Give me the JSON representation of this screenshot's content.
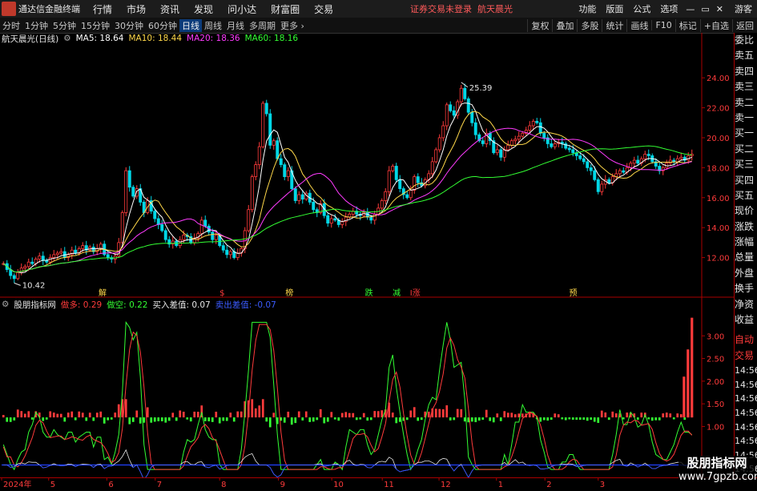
{
  "app": {
    "title": "通达信金融终端",
    "status": "证券交易未登录",
    "stock_name": "航天晨光"
  },
  "menu": [
    "行情",
    "市场",
    "资讯",
    "发现",
    "问小达",
    "财富圈",
    "交易"
  ],
  "right_menu": [
    "功能",
    "版面",
    "公式",
    "选项",
    "游客"
  ],
  "periods": [
    "分时",
    "1分钟",
    "5分钟",
    "15分钟",
    "30分钟",
    "60分钟",
    "日线",
    "周线",
    "月线",
    "多周期",
    "更多"
  ],
  "active_period": "日线",
  "tools": [
    "复权",
    "叠加",
    "多股",
    "统计",
    "画线",
    "F10",
    "标记",
    "+自选",
    "返回"
  ],
  "main_info": {
    "name": "航天晨光(日线)",
    "ma5": "MA5: 18.64",
    "ma10": "MA10: 18.44",
    "ma20": "MA20: 18.36",
    "ma60": "MA60: 18.16"
  },
  "indicator_info": {
    "name": "股朋指标网",
    "duo": "做多: 0.29",
    "kong": "做空: 0.22",
    "buy": "买入差值: 0.07",
    "sell": "卖出差值: -0.07"
  },
  "price_axis": [
    "24.00",
    "22.00",
    "20.00",
    "18.00",
    "16.00",
    "14.00",
    "12.00"
  ],
  "indicator_axis": [
    "3.00",
    "2.50",
    "2.00",
    "1.50",
    "1.00"
  ],
  "annotations": {
    "high": "25.39",
    "low": "10.42"
  },
  "event_markers": [
    "解",
    "$",
    "榜",
    "跌",
    "减",
    "I涨",
    "预"
  ],
  "x_labels": [
    "2024年",
    "5",
    "6",
    "7",
    "8",
    "9",
    "10",
    "11",
    "12",
    "1",
    "2",
    "3"
  ],
  "side_panel": [
    "委比",
    "卖五",
    "卖四",
    "卖三",
    "卖二",
    "卖一",
    "买一",
    "买二",
    "买三",
    "买四",
    "买五",
    "现价",
    "涨跌",
    "涨幅",
    "总量",
    "外盘",
    "换手",
    "净资",
    "收益"
  ],
  "side_panel2": [
    "自动",
    "交易"
  ],
  "side_times": [
    "14:56",
    "14:56",
    "14:56",
    "14:56",
    "14:56",
    "14:56",
    "14:56",
    "14:56",
    "14:56"
  ],
  "watermark": {
    "line1": "股朋指标网",
    "line2": "www.7gpzb.com"
  },
  "colors": {
    "up": "#ff3b3b",
    "down": "#00d7e6",
    "ma5": "#ffffff",
    "ma10": "#ffd84a",
    "ma20": "#ff3bff",
    "ma60": "#33ff33",
    "accent": "#ff3b3b"
  },
  "chart_data": {
    "type": "candlestick",
    "price_ylim": [
      10.0,
      26.2
    ],
    "close_series": [
      11.6,
      11.2,
      10.8,
      10.6,
      11.0,
      11.3,
      11.4,
      11.7,
      11.6,
      11.9,
      12.1,
      11.8,
      11.7,
      12.0,
      12.2,
      12.3,
      12.4,
      12.0,
      12.2,
      12.5,
      12.3,
      12.6,
      12.8,
      12.5,
      12.7,
      12.4,
      12.6,
      12.9,
      12.2,
      12.0,
      11.9,
      12.1,
      13.0,
      15.0,
      17.8,
      16.7,
      16.1,
      16.6,
      15.7,
      15.0,
      15.8,
      15.1,
      14.6,
      14.2,
      13.8,
      13.2,
      12.9,
      13.1,
      12.8,
      13.2,
      13.5,
      13.4,
      13.0,
      13.3,
      13.6,
      14.5,
      14.1,
      13.7,
      13.2,
      13.5,
      12.8,
      12.5,
      12.2,
      12.4,
      12.0,
      12.3,
      12.6,
      13.8,
      15.2,
      17.4,
      18.2,
      19.4,
      22.3,
      21.6,
      19.5,
      19.8,
      18.6,
      18.2,
      17.4,
      17.8,
      16.6,
      15.8,
      16.2,
      15.9,
      16.3,
      15.7,
      15.2,
      15.0,
      15.6,
      14.8,
      14.3,
      14.6,
      14.5,
      14.2,
      14.4,
      14.7,
      14.9,
      15.1,
      14.9,
      14.8,
      15.0,
      14.7,
      14.5,
      14.9,
      15.3,
      15.8,
      16.4,
      17.8,
      18.1,
      17.2,
      16.6,
      16.2,
      16.0,
      16.5,
      17.4,
      17.0,
      16.8,
      17.2,
      17.6,
      18.4,
      19.2,
      20.0,
      20.8,
      22.2,
      21.8,
      21.5,
      22.4,
      23.3,
      22.6,
      21.7,
      21.0,
      20.2,
      19.8,
      19.6,
      20.3,
      19.8,
      19.0,
      19.2,
      18.7,
      19.2,
      19.5,
      19.8,
      19.9,
      20.1,
      20.3,
      20.5,
      20.8,
      21.1,
      21.0,
      20.3,
      20.0,
      19.6,
      19.4,
      19.6,
      19.7,
      19.6,
      19.3,
      19.2,
      19.0,
      18.8,
      18.6,
      18.4,
      18.0,
      17.8,
      17.2,
      16.4,
      16.9,
      17.2,
      17.0,
      17.4,
      17.6,
      17.8,
      17.7,
      18.0,
      18.3,
      18.5,
      18.3,
      18.6,
      18.9,
      18.8,
      18.4,
      18.1,
      17.8,
      18.0,
      18.3,
      18.5,
      18.4,
      18.6,
      18.7,
      18.5,
      18.8,
      18.9
    ],
    "ma60_end": 18.16,
    "indicator_ylim": [
      0.0,
      3.5
    ],
    "series": [
      {
        "name": "做多",
        "last": 0.29
      },
      {
        "name": "做空",
        "last": 0.22
      },
      {
        "name": "买入差值",
        "last": 0.07
      },
      {
        "name": "卖出差值",
        "last": -0.07
      }
    ]
  }
}
